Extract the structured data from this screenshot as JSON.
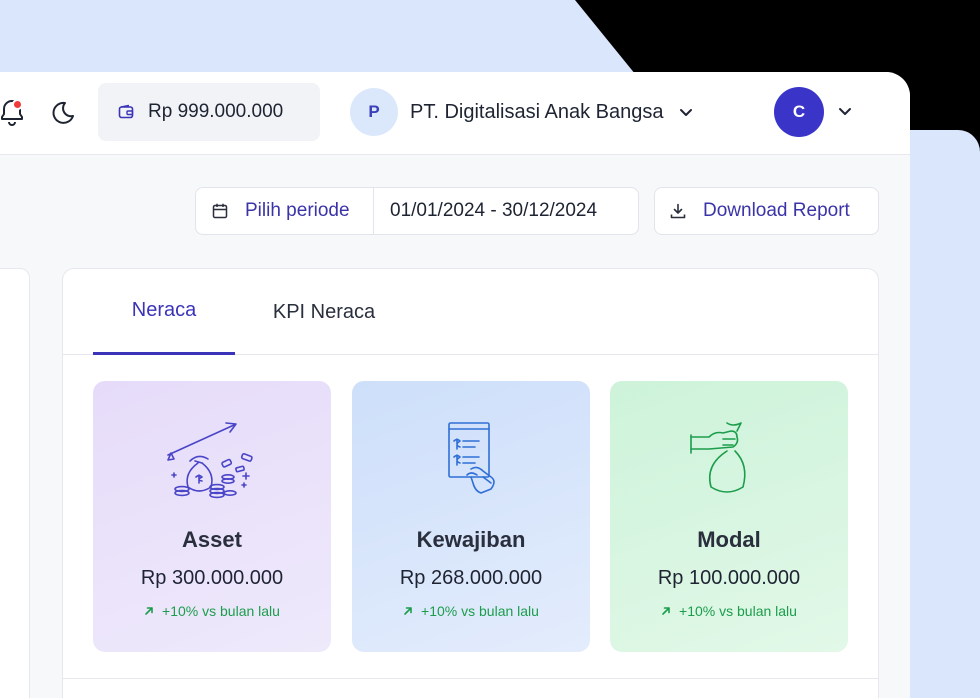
{
  "topbar": {
    "balance": "Rp 999.000.000",
    "company": {
      "initial": "P",
      "name": "PT. Digitalisasi Anak Bangsa"
    },
    "user_initial": "C"
  },
  "toolbar": {
    "period_label": "Pilih periode",
    "period_value": "01/01/2024 - 30/12/2024",
    "download_label": "Download Report"
  },
  "tabs": [
    {
      "label": "Neraca",
      "active": true
    },
    {
      "label": "KPI Neraca",
      "active": false
    }
  ],
  "cards": [
    {
      "title": "Asset",
      "value": "Rp 300.000.000",
      "change": "+10% vs bulan lalu",
      "icon": "money-bag-growth-icon"
    },
    {
      "title": "Kewajiban",
      "value": "Rp 268.000.000",
      "change": "+10% vs bulan lalu",
      "icon": "invoice-hand-icon"
    },
    {
      "title": "Modal",
      "value": "Rp 100.000.000",
      "change": "+10% vs bulan lalu",
      "icon": "hand-money-bag-icon"
    }
  ],
  "colors": {
    "accent": "#3b34b8",
    "notification": "#ef3b3b",
    "positive": "#1c9d4c"
  }
}
